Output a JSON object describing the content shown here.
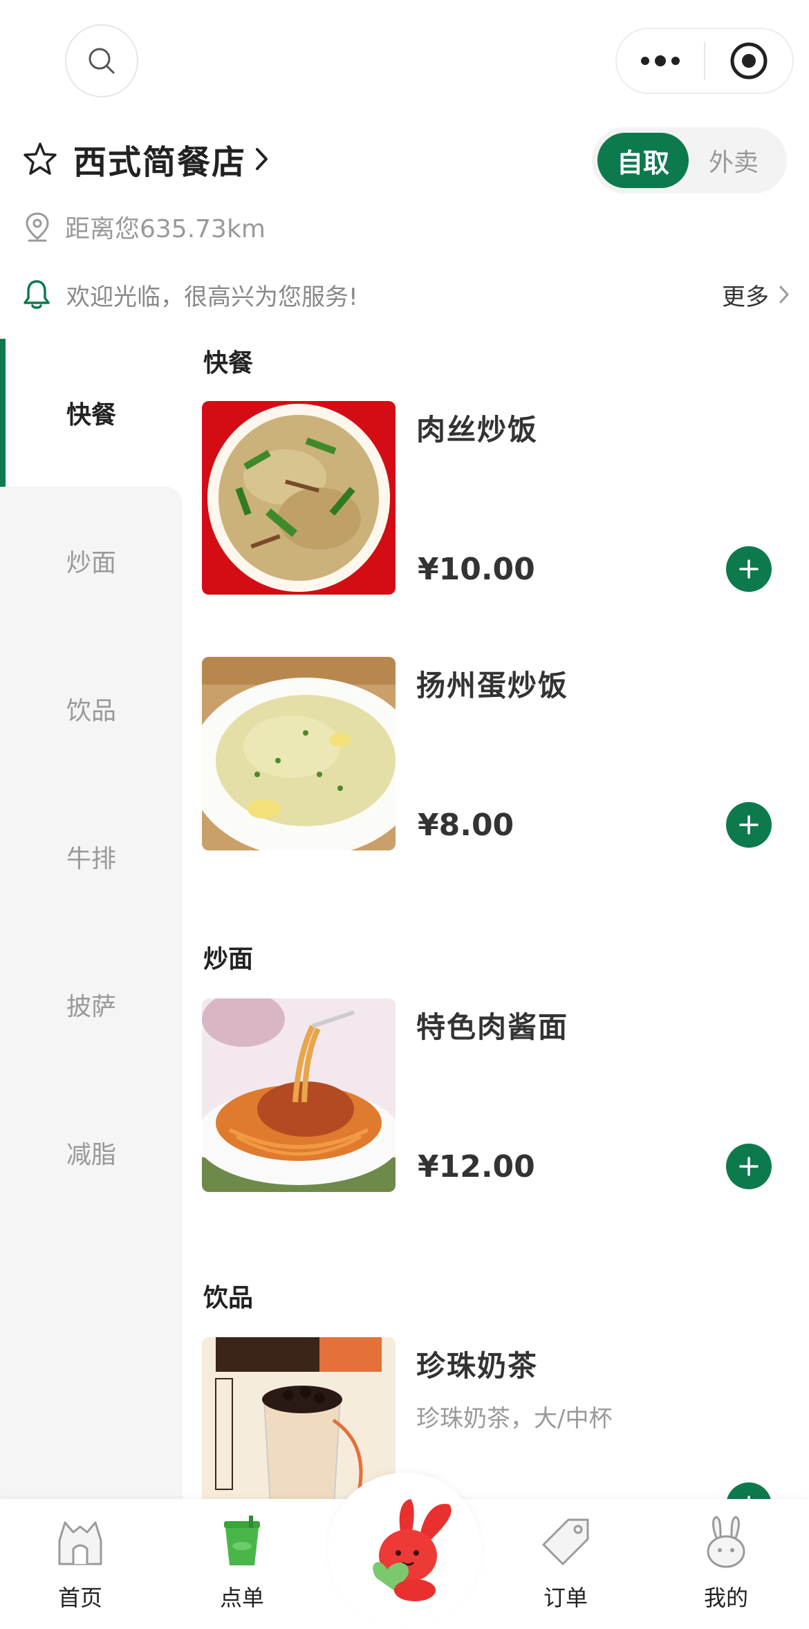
{
  "store": {
    "name": "西式简餐店",
    "distance": "距离您635.73km",
    "notice": "欢迎光临，很高兴为您服务!",
    "notice_more": "更多"
  },
  "mode": {
    "active": "自取",
    "inactive": "外卖"
  },
  "sidebar": {
    "items": [
      {
        "label": "快餐",
        "active": true
      },
      {
        "label": "炒面",
        "active": false
      },
      {
        "label": "饮品",
        "active": false
      },
      {
        "label": "牛排",
        "active": false
      },
      {
        "label": "披萨",
        "active": false
      },
      {
        "label": "减脂",
        "active": false
      }
    ]
  },
  "menu": {
    "sections": [
      {
        "title": "快餐",
        "dishes": [
          {
            "name": "肉丝炒饭",
            "price": "¥10.00",
            "description": ""
          },
          {
            "name": "扬州蛋炒饭",
            "price": "¥8.00",
            "description": ""
          }
        ]
      },
      {
        "title": "炒面",
        "dishes": [
          {
            "name": "特色肉酱面",
            "price": "¥12.00",
            "description": ""
          }
        ]
      },
      {
        "title": "饮品",
        "dishes": [
          {
            "name": "珍珠奶茶",
            "price": "",
            "description": "珍珠奶茶，大/中杯"
          }
        ]
      }
    ]
  },
  "tabbar": {
    "items": [
      {
        "label": "首页",
        "icon": "home-icon"
      },
      {
        "label": "点单",
        "icon": "order-cup-icon"
      },
      {
        "label": "订单",
        "icon": "tag-icon"
      },
      {
        "label": "我的",
        "icon": "rabbit-icon"
      }
    ]
  },
  "colors": {
    "accent": "#0d7a4e",
    "sidebar_bg": "#f5f5f5"
  }
}
